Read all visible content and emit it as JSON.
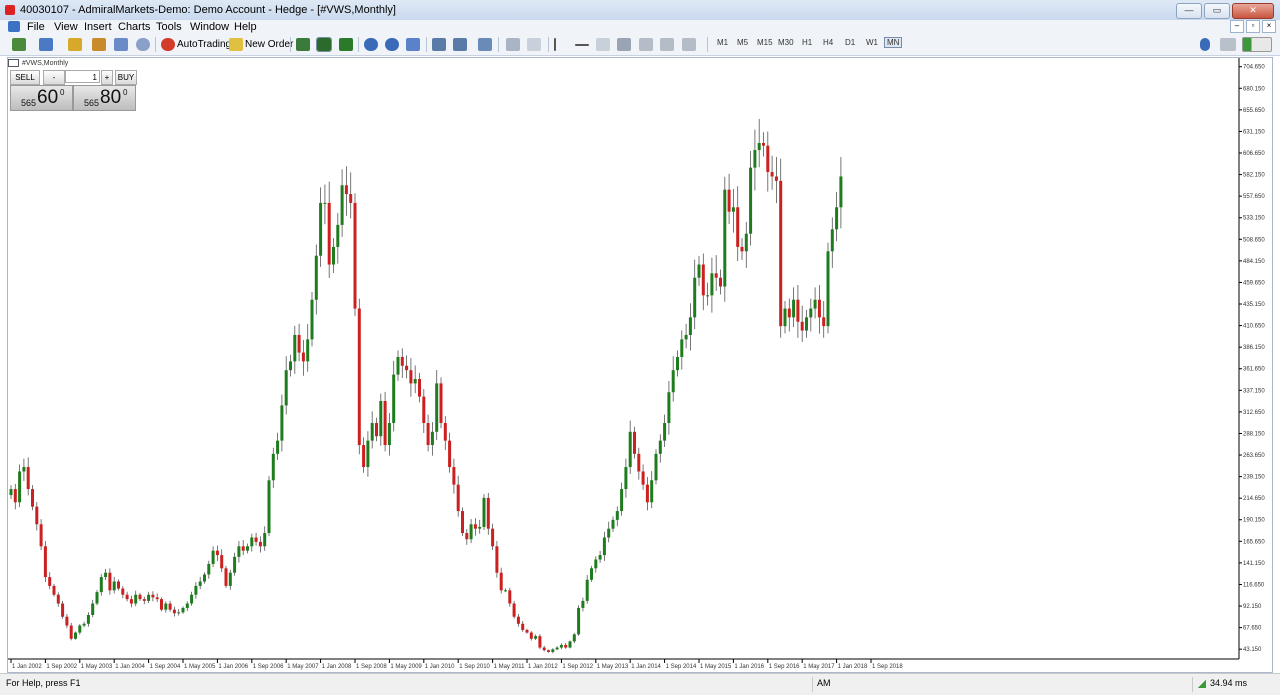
{
  "window": {
    "title": "40030107 - AdmiralMarkets-Demo: Demo Account - Hedge - [#VWS,Monthly]",
    "buttons": [
      "—",
      "▭",
      "✕"
    ]
  },
  "menu": [
    "File",
    "View",
    "Insert",
    "Charts",
    "Tools",
    "Window",
    "Help"
  ],
  "mdi_buttons": [
    "–",
    "▫",
    "×"
  ],
  "toolbar": {
    "autotrading_label": "AutoTrading",
    "new_order_label": "New Order",
    "timeframes": [
      "M1",
      "M5",
      "M15",
      "M30",
      "H1",
      "H4",
      "D1",
      "W1",
      "MN"
    ],
    "active_timeframe": "MN"
  },
  "chart_window": {
    "title": "#VWS,Monthly"
  },
  "trade_panel": {
    "sell_label": "SELL",
    "buy_label": "BUY",
    "quantity": "1",
    "bid_small": "565",
    "bid_big": "60",
    "bid_sup": "0",
    "ask_small": "565",
    "ask_big": "80",
    "ask_sup": "0"
  },
  "status": {
    "help": "For Help, press F1",
    "session": "AM",
    "connection": "34.94 ms"
  },
  "colors": {
    "up": "#1e7c1e",
    "down": "#cc1f1f",
    "wick": "#555555",
    "grid_text": "#333333"
  },
  "chart_data": {
    "type": "candlestick",
    "symbol": "#VWS",
    "timeframe": "Monthly",
    "ylim": [
      32.0,
      710.0
    ],
    "y_ticks": [
      "704.650",
      "680.150",
      "655.650",
      "631.150",
      "606.650",
      "582.150",
      "557.650",
      "533.150",
      "508.650",
      "484.150",
      "459.650",
      "435.150",
      "410.650",
      "386.150",
      "361.650",
      "337.150",
      "312.650",
      "288.150",
      "263.650",
      "239.150",
      "214.650",
      "190.150",
      "165.650",
      "141.150",
      "116.650",
      "92.150",
      "67.650",
      "43.150"
    ],
    "x_labels": [
      "1 Jan 2002",
      "1 Sep 2002",
      "1 May 2003",
      "1 Jan 2004",
      "1 Sep 2004",
      "1 May 2005",
      "1 Jan 2006",
      "1 Sep 2006",
      "1 May 2007",
      "1 Jan 2008",
      "1 Sep 2008",
      "1 May 2009",
      "1 Jan 2010",
      "1 Sep 2010",
      "1 May 2011",
      "1 Jan 2012",
      "1 Sep 2012",
      "1 May 2013",
      "1 Jan 2014",
      "1 Sep 2014",
      "1 May 2015",
      "1 Jan 2016",
      "1 Sep 2016",
      "1 May 2017",
      "1 Jan 2018",
      "1 Sep 2018"
    ],
    "closes": [
      225,
      210,
      245,
      250,
      225,
      205,
      185,
      160,
      125,
      115,
      105,
      95,
      80,
      70,
      55,
      62,
      70,
      72,
      82,
      95,
      108,
      125,
      130,
      110,
      120,
      112,
      105,
      100,
      95,
      105,
      100,
      98,
      105,
      102,
      100,
      88,
      95,
      88,
      84,
      85,
      90,
      95,
      105,
      115,
      120,
      128,
      140,
      155,
      150,
      135,
      115,
      130,
      148,
      160,
      155,
      160,
      170,
      165,
      160,
      175,
      235,
      265,
      280,
      320,
      360,
      370,
      400,
      380,
      370,
      395,
      440,
      490,
      550,
      550,
      480,
      500,
      525,
      570,
      560,
      550,
      430,
      275,
      250,
      280,
      300,
      285,
      325,
      275,
      300,
      355,
      375,
      365,
      360,
      345,
      350,
      330,
      300,
      275,
      290,
      345,
      300,
      280,
      250,
      230,
      200,
      175,
      168,
      185,
      180,
      182,
      215,
      180,
      160,
      130,
      110,
      110,
      95,
      80,
      72,
      65,
      62,
      55,
      58,
      45,
      42,
      40,
      43,
      45,
      48,
      45,
      52,
      60,
      90,
      98,
      122,
      135,
      145,
      150,
      170,
      180,
      190,
      200,
      225,
      250,
      290,
      265,
      245,
      230,
      210,
      235,
      265,
      280,
      300,
      335,
      360,
      375,
      395,
      400,
      420,
      465,
      480,
      445,
      445,
      470,
      465,
      455,
      565,
      540,
      545,
      500,
      495,
      515,
      590,
      610,
      618,
      615,
      585,
      580,
      575,
      410,
      430,
      420,
      440,
      415,
      405,
      420,
      430,
      440,
      420,
      410,
      495,
      520,
      545,
      580
    ]
  }
}
